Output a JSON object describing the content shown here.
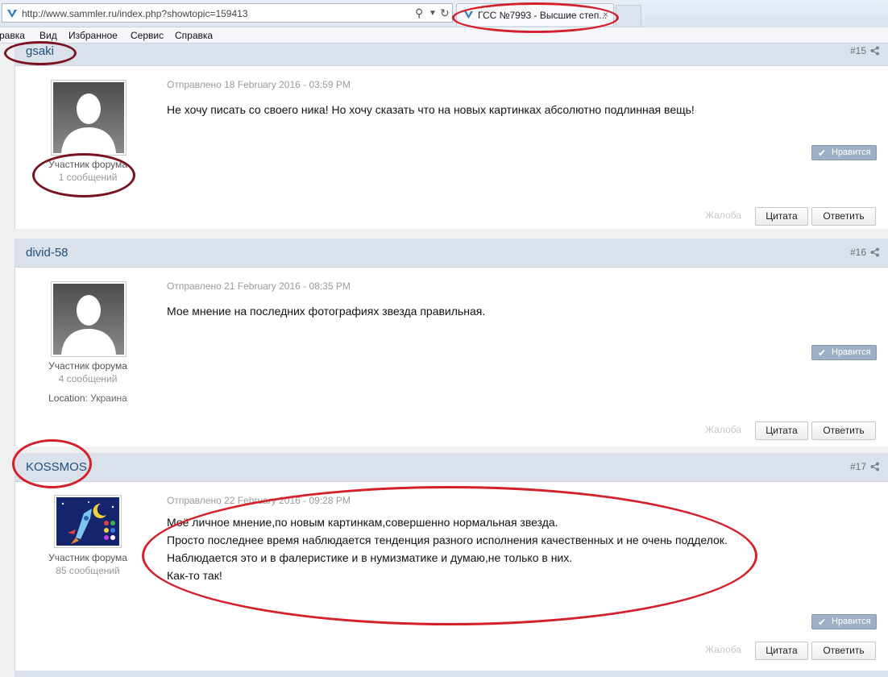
{
  "browser": {
    "url": "http://www.sammler.ru/index.php?showtopic=159413",
    "tab_title": "ГСС №7993 - Высшие степ...",
    "tab_close": "×"
  },
  "menu": [
    "равка",
    "Вид",
    "Избранное",
    "Сервис",
    "Справка"
  ],
  "posts": [
    {
      "author": "gsaki",
      "number": "#15",
      "role": "Участник форума",
      "count": "1 сообщений",
      "location_label": "",
      "location_value": "",
      "posted": "Отправлено 18 February 2016 - 03:59 PM",
      "lines": [
        "Не хочу писать со своего ника! Но хочу сказать что на новых картинках абсолютно подлинная вещь!"
      ],
      "like": "Нравится",
      "report": "Жалоба",
      "quote": "Цитата",
      "reply": "Ответить"
    },
    {
      "author": "divid-58",
      "number": "#16",
      "role": "Участник форума",
      "count": "4 сообщений",
      "location_label": "Location:",
      "location_value": "Украина",
      "posted": "Отправлено 21 February 2016 - 08:35 PM",
      "lines": [
        "Мое мнение на последних фотографиях звезда правильная."
      ],
      "like": "Нравится",
      "report": "Жалоба",
      "quote": "Цитата",
      "reply": "Ответить"
    },
    {
      "author": "KOSSMOS",
      "number": "#17",
      "role": "Участник форума",
      "count": "85 сообщений",
      "location_label": "",
      "location_value": "",
      "posted": "Отправлено 22 February 2016 - 09:28 PM",
      "lines": [
        "Моё личное мнение,по новым картинкам,совершенно нормальная звезда.",
        "Просто последнее время наблюдается тенденция разного исполнения качественных и не очень подделок.",
        "Наблюдается это и в фалеристике и в нумизматике и думаю,не только в них.",
        "Как-то так!"
      ],
      "like": "Нравится",
      "report": "Жалоба",
      "quote": "Цитата",
      "reply": "Ответить"
    }
  ],
  "colors": {
    "annotation_red": "#d4202a",
    "annotation_darkred": "#7a1220",
    "author_link": "#1d4f80",
    "header_bg": "#dbe1ea"
  }
}
